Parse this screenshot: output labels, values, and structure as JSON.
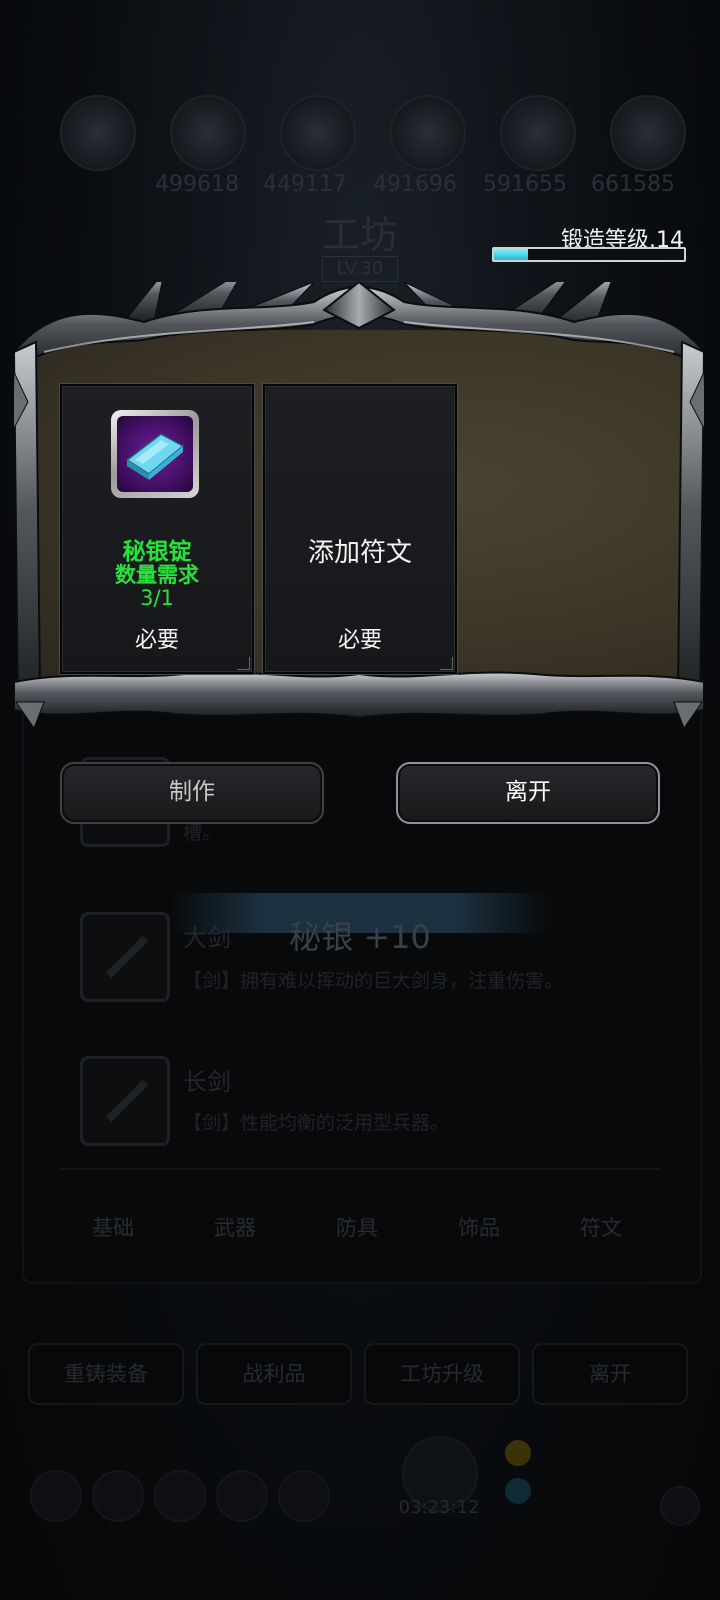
{
  "background": {
    "resources": [
      "499618",
      "449117",
      "491696",
      "591655",
      "661585"
    ],
    "title": "工坊",
    "level": "LV.30",
    "items": [
      {
        "name": "",
        "desc": "槽。"
      },
      {
        "name": "大剑",
        "desc": "【剑】拥有难以挥动的巨大剑身，注重伤害。"
      },
      {
        "name": "长剑",
        "desc": "【剑】性能均衡的泛用型兵器。"
      }
    ],
    "banner": "秘银 +10",
    "tabs": [
      "基础",
      "武器",
      "防具",
      "饰品",
      "符文"
    ],
    "bottom_buttons": [
      "重铸装备",
      "战利品",
      "工坊升级",
      "离开"
    ],
    "timer": "03:23:12"
  },
  "forge": {
    "level_label": "锻造等级.14",
    "progress": 0.18
  },
  "slots": {
    "material": {
      "name": "秘银锭",
      "requirement_label": "数量需求",
      "quantity": "3/1",
      "required": "必要"
    },
    "rune": {
      "name": "添加符文",
      "required": "必要"
    }
  },
  "actions": {
    "make": "制作",
    "leave": "离开"
  },
  "colors": {
    "accent_green": "#27e23a",
    "progress_cyan": "#27b7d4",
    "parchment": "#3c3627"
  }
}
